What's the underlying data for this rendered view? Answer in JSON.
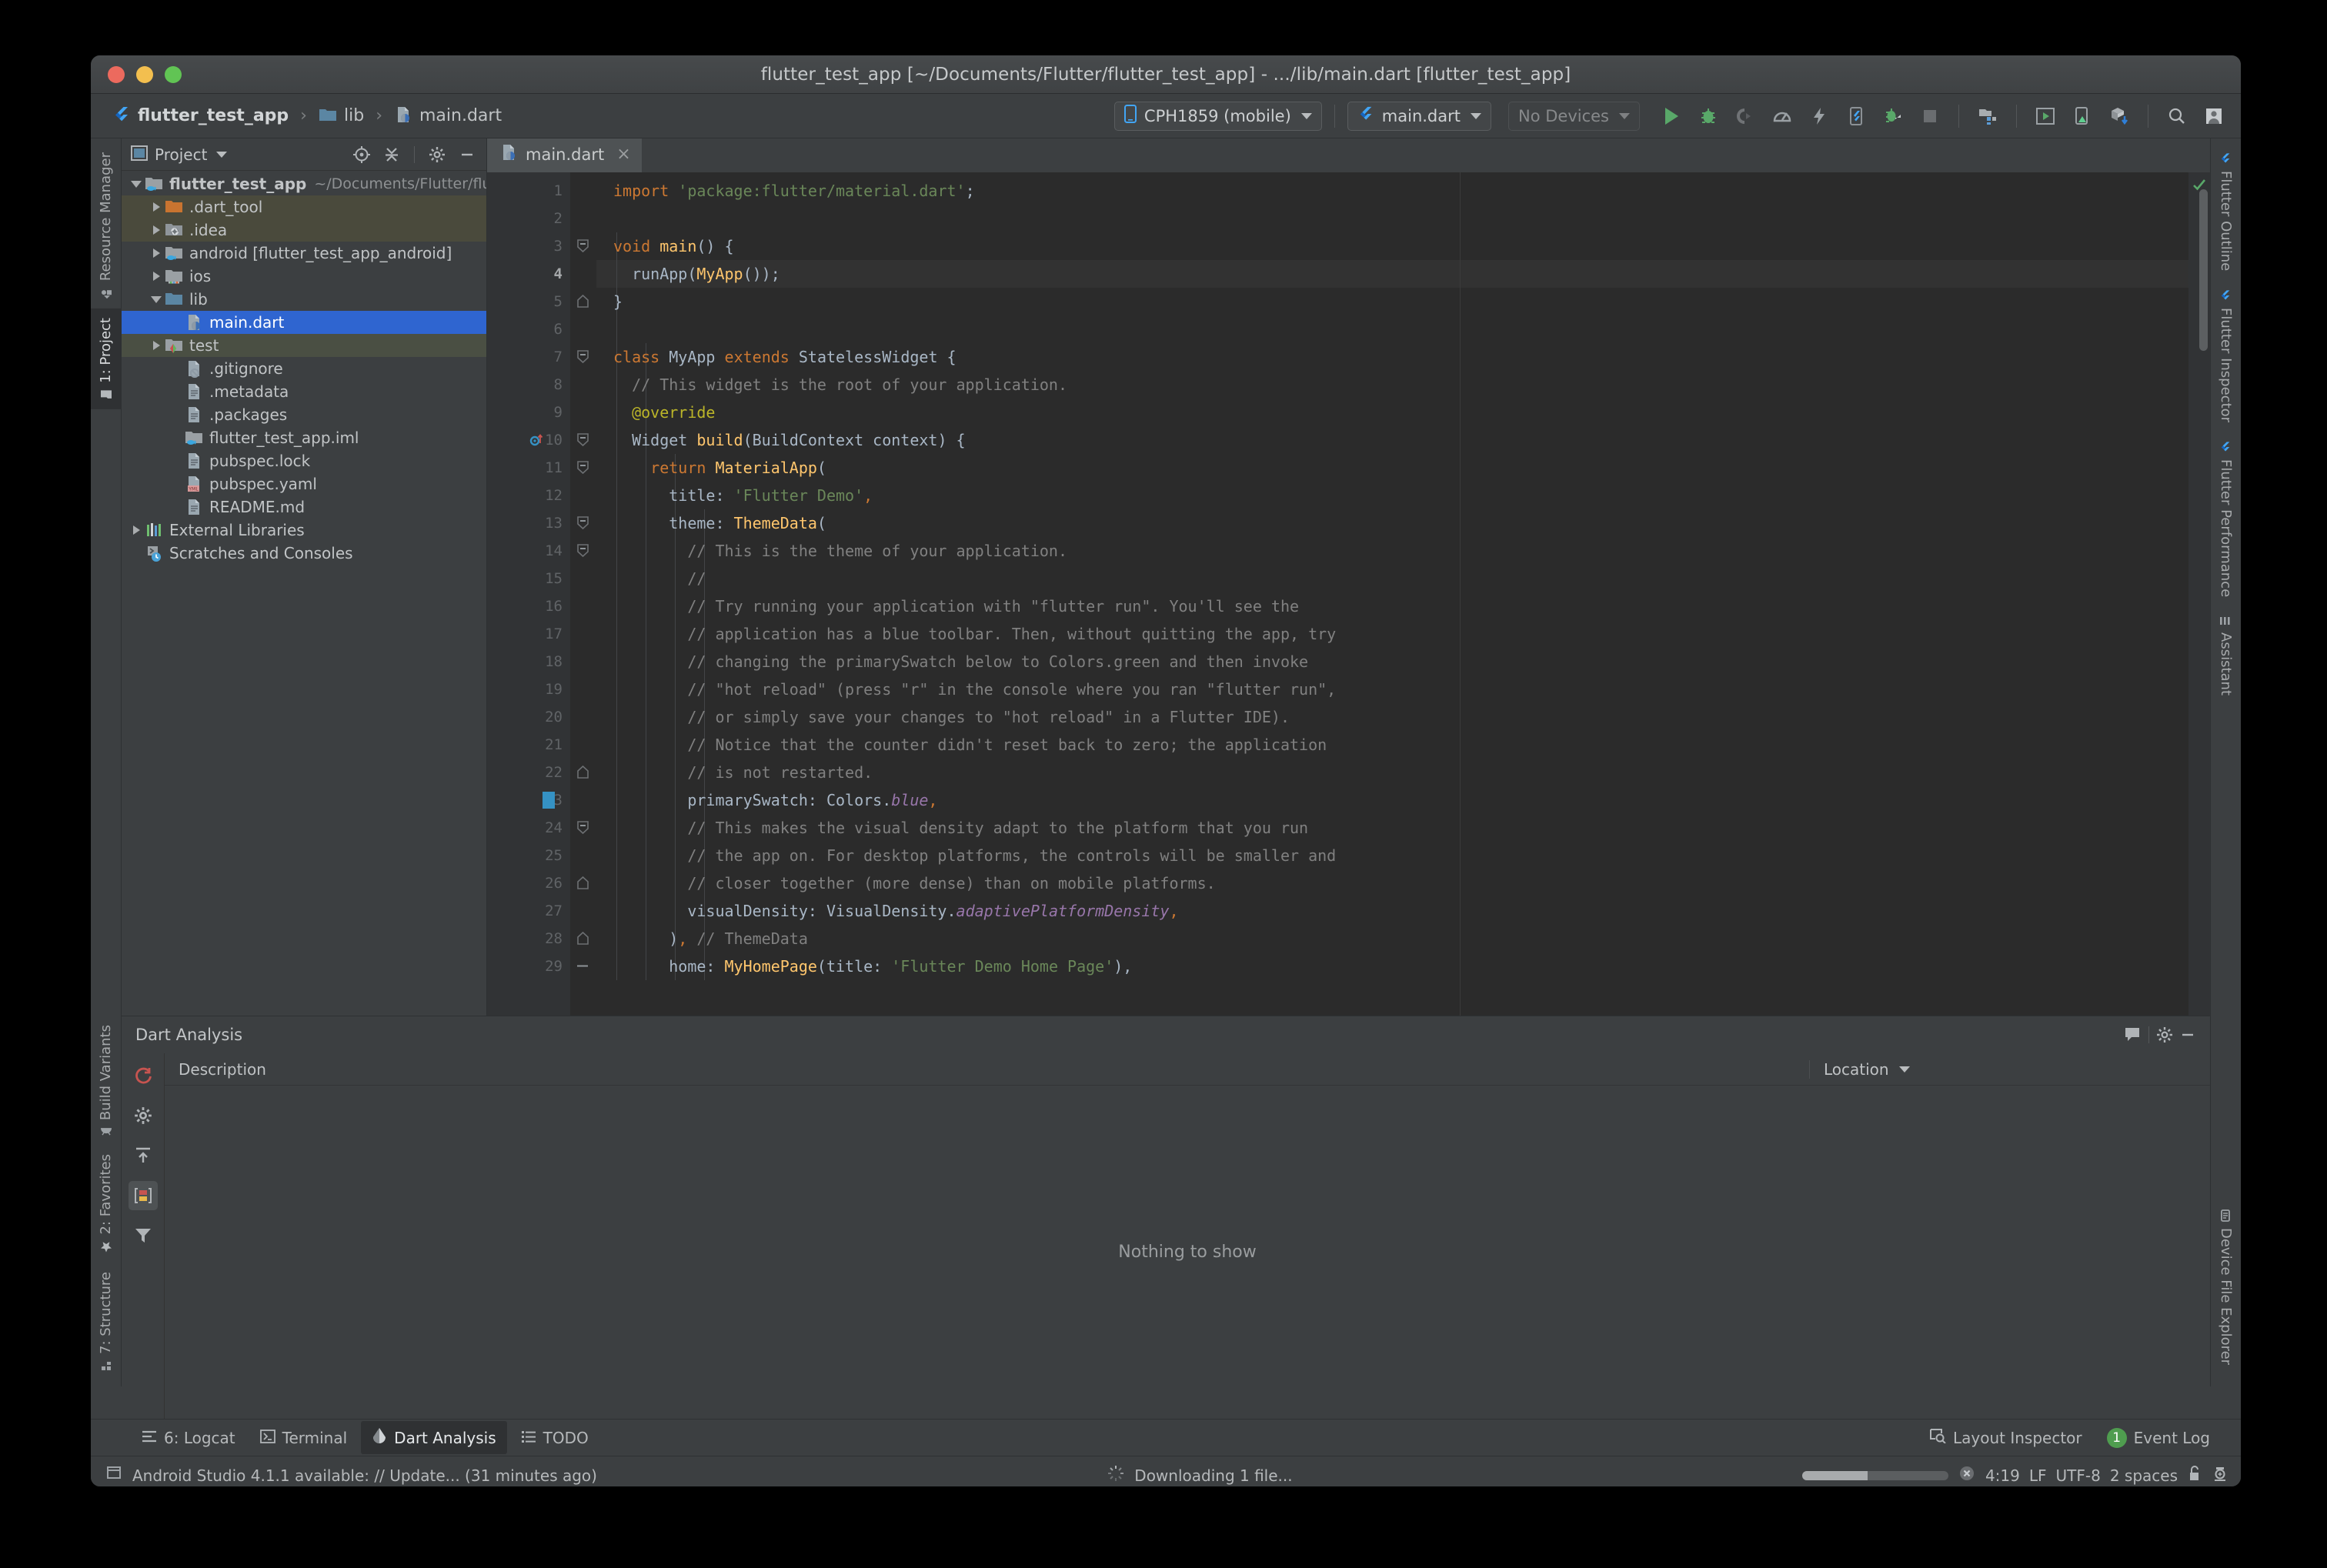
{
  "window": {
    "title": "flutter_test_app [~/Documents/Flutter/flutter_test_app] - .../lib/main.dart [flutter_test_app]"
  },
  "breadcrumb": {
    "items": [
      {
        "label": "flutter_test_app",
        "icon": "flutter-icon"
      },
      {
        "label": "lib",
        "icon": "folder-icon"
      },
      {
        "label": "main.dart",
        "icon": "dart-file-icon"
      }
    ],
    "separator": "›"
  },
  "toolbar": {
    "device_selector": "CPH1859 (mobile)",
    "run_config": "main.dart",
    "devices_selector": "No Devices",
    "buttons": [
      {
        "name": "run-button",
        "label": "Run"
      },
      {
        "name": "debug-button",
        "label": "Debug"
      },
      {
        "name": "profile-button",
        "label": "Profile"
      },
      {
        "name": "run-profile-mode-button",
        "label": "Run in profile mode"
      },
      {
        "name": "hot-reload-button",
        "label": "Hot Reload"
      },
      {
        "name": "open-devtools-button",
        "label": "Open DevTools"
      },
      {
        "name": "attach-debugger-button",
        "label": "Attach debugger"
      },
      {
        "name": "stop-button",
        "label": "Stop"
      },
      {
        "name": "project-structure-button",
        "label": "Project Structure"
      },
      {
        "name": "avd-manager-button",
        "label": "AVD Manager"
      },
      {
        "name": "device-manager-button",
        "label": "Device Manager"
      },
      {
        "name": "sdk-manager-button",
        "label": "SDK Manager"
      },
      {
        "name": "search-everywhere-button",
        "label": "Search Everywhere"
      },
      {
        "name": "user-account-button",
        "label": "Account"
      }
    ]
  },
  "project_panel": {
    "title": "Project",
    "tools": [
      {
        "name": "select-opened-file-icon",
        "label": "Select Opened File"
      },
      {
        "name": "collapse-all-icon",
        "label": "Collapse All"
      },
      {
        "name": "settings-gear-icon",
        "label": "Settings"
      },
      {
        "name": "hide-panel-icon",
        "label": "Hide"
      }
    ],
    "tree": [
      {
        "label": "flutter_test_app",
        "sub": "~/Documents/Flutter/flutter",
        "depth": 0,
        "arrow": "open",
        "icon": "module-folder-icon",
        "bold": true,
        "state": "normal"
      },
      {
        "label": ".dart_tool",
        "sub": "",
        "depth": 1,
        "arrow": "closed",
        "icon": "folder-orange-icon",
        "bold": false,
        "state": "olive"
      },
      {
        "label": ".idea",
        "sub": "",
        "depth": 1,
        "arrow": "closed",
        "icon": "folder-idea-icon",
        "bold": false,
        "state": "olive"
      },
      {
        "label": "android [flutter_test_app_android]",
        "sub": "",
        "depth": 1,
        "arrow": "closed",
        "icon": "module-folder-icon",
        "bold": false,
        "state": "normal"
      },
      {
        "label": "ios",
        "sub": "",
        "depth": 1,
        "arrow": "closed",
        "icon": "folder-ios-icon",
        "bold": false,
        "state": "normal"
      },
      {
        "label": "lib",
        "sub": "",
        "depth": 1,
        "arrow": "open",
        "icon": "folder-blue-icon",
        "bold": false,
        "state": "normal"
      },
      {
        "label": "main.dart",
        "sub": "",
        "depth": 2,
        "arrow": "none",
        "icon": "dart-file-icon",
        "bold": false,
        "state": "selected"
      },
      {
        "label": "test",
        "sub": "",
        "depth": 1,
        "arrow": "closed",
        "icon": "folder-test-icon",
        "bold": false,
        "state": "green"
      },
      {
        "label": ".gitignore",
        "sub": "",
        "depth": 2,
        "arrow": "none",
        "icon": "gitignore-file-icon",
        "bold": false,
        "state": "normal"
      },
      {
        "label": ".metadata",
        "sub": "",
        "depth": 2,
        "arrow": "none",
        "icon": "text-file-icon",
        "bold": false,
        "state": "normal"
      },
      {
        "label": ".packages",
        "sub": "",
        "depth": 2,
        "arrow": "none",
        "icon": "text-file-icon",
        "bold": false,
        "state": "normal"
      },
      {
        "label": "flutter_test_app.iml",
        "sub": "",
        "depth": 2,
        "arrow": "none",
        "icon": "iml-file-icon",
        "bold": false,
        "state": "normal"
      },
      {
        "label": "pubspec.lock",
        "sub": "",
        "depth": 2,
        "arrow": "none",
        "icon": "text-file-icon",
        "bold": false,
        "state": "normal"
      },
      {
        "label": "pubspec.yaml",
        "sub": "",
        "depth": 2,
        "arrow": "none",
        "icon": "yaml-file-icon",
        "bold": false,
        "state": "normal"
      },
      {
        "label": "README.md",
        "sub": "",
        "depth": 2,
        "arrow": "none",
        "icon": "text-file-icon",
        "bold": false,
        "state": "normal"
      },
      {
        "label": "External Libraries",
        "sub": "",
        "depth": 0,
        "arrow": "closed",
        "icon": "libraries-icon",
        "bold": false,
        "state": "normal"
      },
      {
        "label": "Scratches and Consoles",
        "sub": "",
        "depth": 0,
        "arrow": "none",
        "icon": "scratches-icon",
        "bold": false,
        "state": "normal"
      }
    ]
  },
  "left_tabs_top": [
    {
      "label": "Resource Manager",
      "active": false,
      "icon": "resource-manager-icon"
    },
    {
      "label": "1: Project",
      "active": true,
      "icon": "project-folder-icon"
    }
  ],
  "left_tabs_bottom": [
    {
      "label": "Build Variants",
      "active": false,
      "icon": "android-icon"
    },
    {
      "label": "2: Favorites",
      "active": false,
      "icon": "star-icon"
    },
    {
      "label": "7: Structure",
      "active": false,
      "icon": "structure-icon"
    }
  ],
  "right_tabs": [
    {
      "label": "Flutter Outline",
      "icon": "flutter-icon"
    },
    {
      "label": "Flutter Inspector",
      "icon": "flutter-icon"
    },
    {
      "label": "Flutter Performance",
      "icon": "flutter-icon"
    },
    {
      "label": "Assistant",
      "icon": "assistant-icon"
    }
  ],
  "right_tabs_bottom": [
    {
      "label": "Device File Explorer",
      "icon": "device-file-explorer-icon"
    }
  ],
  "editor": {
    "tab": {
      "label": "main.dart",
      "close": "×",
      "icon": "dart-file-icon"
    },
    "current_line": 4,
    "caret_position": "4:19",
    "lines": [
      {
        "n": 1,
        "indent": 0,
        "fold": "",
        "tokens": [
          [
            "kw",
            "import"
          ],
          [
            "plain",
            " "
          ],
          [
            "str",
            "'package:flutter/material.dart'"
          ],
          [
            "plain",
            ";"
          ]
        ]
      },
      {
        "n": 2,
        "indent": 0,
        "fold": "",
        "tokens": []
      },
      {
        "n": 3,
        "indent": 0,
        "fold": "start",
        "tokens": [
          [
            "kw",
            "void"
          ],
          [
            "plain",
            " "
          ],
          [
            "fn",
            "main"
          ],
          [
            "plain",
            "() {"
          ]
        ]
      },
      {
        "n": 4,
        "indent": 0,
        "fold": "",
        "tokens": [
          [
            "plain",
            "  runApp("
          ],
          [
            "fn",
            "MyApp"
          ],
          [
            "plain",
            "());"
          ]
        ]
      },
      {
        "n": 5,
        "indent": 0,
        "fold": "end",
        "tokens": [
          [
            "plain",
            "}"
          ]
        ]
      },
      {
        "n": 6,
        "indent": 0,
        "fold": "",
        "tokens": []
      },
      {
        "n": 7,
        "indent": 0,
        "fold": "start",
        "tokens": [
          [
            "kw",
            "class"
          ],
          [
            "plain",
            " "
          ],
          [
            "cls",
            "MyApp"
          ],
          [
            "plain",
            " "
          ],
          [
            "kw",
            "extends"
          ],
          [
            "plain",
            " "
          ],
          [
            "cls",
            "StatelessWidget"
          ],
          [
            "plain",
            " {"
          ]
        ]
      },
      {
        "n": 8,
        "indent": 1,
        "fold": "",
        "tokens": [
          [
            "cmt",
            "  // This widget is the root of your application."
          ]
        ]
      },
      {
        "n": 9,
        "indent": 1,
        "fold": "",
        "tokens": [
          [
            "ann",
            "  @override"
          ]
        ]
      },
      {
        "n": 10,
        "indent": 1,
        "fold": "start",
        "tokens": [
          [
            "cls",
            "  Widget "
          ],
          [
            "fn",
            "build"
          ],
          [
            "plain",
            "("
          ],
          [
            "cls",
            "BuildContext"
          ],
          [
            "plain",
            " context) {"
          ]
        ]
      },
      {
        "n": 11,
        "indent": 1,
        "fold": "start",
        "tokens": [
          [
            "kw",
            "    return"
          ],
          [
            "plain",
            " "
          ],
          [
            "fn",
            "MaterialApp"
          ],
          [
            "plain",
            "("
          ]
        ]
      },
      {
        "n": 12,
        "indent": 2,
        "fold": "",
        "tokens": [
          [
            "plain",
            "      title: "
          ],
          [
            "str",
            "'Flutter Demo'"
          ],
          [
            "kw",
            ","
          ]
        ]
      },
      {
        "n": 13,
        "indent": 2,
        "fold": "start",
        "tokens": [
          [
            "plain",
            "      theme: "
          ],
          [
            "fn",
            "ThemeData"
          ],
          [
            "plain",
            "("
          ]
        ]
      },
      {
        "n": 14,
        "indent": 3,
        "fold": "start",
        "tokens": [
          [
            "cmt",
            "        // This is the theme of your application."
          ]
        ]
      },
      {
        "n": 15,
        "indent": 3,
        "fold": "",
        "tokens": [
          [
            "cmt",
            "        //"
          ]
        ]
      },
      {
        "n": 16,
        "indent": 3,
        "fold": "",
        "tokens": [
          [
            "cmt",
            "        // Try running your application with \"flutter run\". You'll see the"
          ]
        ]
      },
      {
        "n": 17,
        "indent": 3,
        "fold": "",
        "tokens": [
          [
            "cmt",
            "        // application has a blue toolbar. Then, without quitting the app, try"
          ]
        ]
      },
      {
        "n": 18,
        "indent": 3,
        "fold": "",
        "tokens": [
          [
            "cmt",
            "        // changing the primarySwatch below to Colors.green and then invoke"
          ]
        ]
      },
      {
        "n": 19,
        "indent": 3,
        "fold": "",
        "tokens": [
          [
            "cmt",
            "        // \"hot reload\" (press \"r\" in the console where you ran \"flutter run\","
          ]
        ]
      },
      {
        "n": 20,
        "indent": 3,
        "fold": "",
        "tokens": [
          [
            "cmt",
            "        // or simply save your changes to \"hot reload\" in a Flutter IDE)."
          ]
        ]
      },
      {
        "n": 21,
        "indent": 3,
        "fold": "",
        "tokens": [
          [
            "cmt",
            "        // Notice that the counter didn't reset back to zero; the application"
          ]
        ]
      },
      {
        "n": 22,
        "indent": 3,
        "fold": "end",
        "tokens": [
          [
            "cmt",
            "        // is not restarted."
          ]
        ]
      },
      {
        "n": 23,
        "indent": 3,
        "fold": "marker",
        "tokens": [
          [
            "plain",
            "        primarySwatch: Colors."
          ],
          [
            "field",
            "blue"
          ],
          [
            "kw",
            ","
          ]
        ]
      },
      {
        "n": 24,
        "indent": 3,
        "fold": "start",
        "tokens": [
          [
            "cmt",
            "        // This makes the visual density adapt to the platform that you run"
          ]
        ]
      },
      {
        "n": 25,
        "indent": 3,
        "fold": "",
        "tokens": [
          [
            "cmt",
            "        // the app on. For desktop platforms, the controls will be smaller and"
          ]
        ]
      },
      {
        "n": 26,
        "indent": 3,
        "fold": "end",
        "tokens": [
          [
            "cmt",
            "        // closer together (more dense) than on mobile platforms."
          ]
        ]
      },
      {
        "n": 27,
        "indent": 3,
        "fold": "",
        "tokens": [
          [
            "plain",
            "        visualDensity: VisualDensity."
          ],
          [
            "field",
            "adaptivePlatformDensity"
          ],
          [
            "kw",
            ","
          ]
        ]
      },
      {
        "n": 28,
        "indent": 2,
        "fold": "end",
        "tokens": [
          [
            "plain",
            "      )"
          ],
          [
            "kw",
            ","
          ],
          [
            "cmt",
            " // ThemeData"
          ]
        ]
      },
      {
        "n": 29,
        "indent": 2,
        "fold": "dash",
        "tokens": [
          [
            "plain",
            "      home: "
          ],
          [
            "fn",
            "MyHomePage"
          ],
          [
            "plain",
            "(title: "
          ],
          [
            "str",
            "'Flutter Demo Home Page'"
          ],
          [
            "plain",
            "),"
          ]
        ]
      }
    ]
  },
  "dart_analysis": {
    "title": "Dart Analysis",
    "columns": {
      "description": "Description",
      "location": "Location"
    },
    "empty_message": "Nothing to show",
    "header_tools": [
      {
        "name": "comment-icon",
        "label": "Comment"
      },
      {
        "name": "settings-gear-icon",
        "label": "Settings"
      },
      {
        "name": "minimize-icon",
        "label": "Hide"
      }
    ],
    "side_tools": [
      {
        "name": "restart-icon",
        "label": "Restart analysis",
        "active": false
      },
      {
        "name": "settings-gear-icon",
        "label": "Analysis settings",
        "active": false
      },
      {
        "name": "expand-icon",
        "label": "Expand",
        "active": false
      },
      {
        "name": "toggle-severity-icon",
        "label": "Group by severity",
        "active": true
      },
      {
        "name": "filter-icon",
        "label": "Filter",
        "active": false
      }
    ]
  },
  "tool_tabs": [
    {
      "label": "6: Logcat",
      "active": false,
      "icon": "logcat-icon",
      "mnemonic": "6"
    },
    {
      "label": "Terminal",
      "active": false,
      "icon": "terminal-icon",
      "mnemonic": ""
    },
    {
      "label": "Dart Analysis",
      "active": true,
      "icon": "dart-icon",
      "mnemonic": ""
    },
    {
      "label": "TODO",
      "active": false,
      "icon": "todo-icon",
      "mnemonic": ""
    }
  ],
  "tool_tabs_right": [
    {
      "label": "Layout Inspector",
      "icon": "layout-inspector-icon"
    },
    {
      "label": "Event Log",
      "icon": "event-log-icon",
      "badge": "1"
    }
  ],
  "status_bar": {
    "message": "Android Studio 4.1.1 available: // Update... (31 minutes ago)",
    "progress_text": "Downloading 1 file...",
    "progress_percent": 45,
    "caret": "4:19",
    "line_separator": "LF",
    "encoding": "UTF-8",
    "indent": "2 spaces",
    "lock_icon": "lock-icon",
    "inspection_icon": "inspection-icon"
  },
  "colors": {
    "accent_blue": "#2f65d0",
    "flutter_blue": "#42a5f5",
    "keyword_orange": "#cc7832",
    "string_green": "#6a8759",
    "comment_gray": "#808080",
    "function_yellow": "#ffc66d",
    "field_purple": "#9876aa",
    "annotation_olive": "#bbb529",
    "editor_bg": "#2b2b2b",
    "panel_bg": "#3c3f41"
  }
}
